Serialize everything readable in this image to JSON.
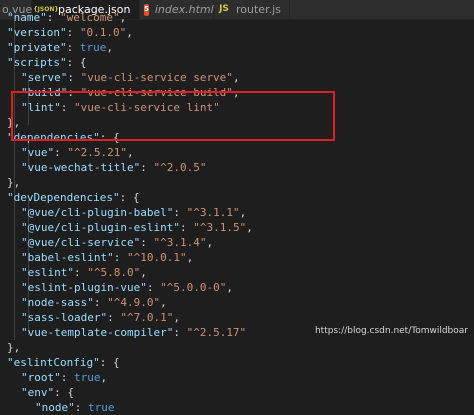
{
  "tabs": [
    {
      "icon": "vue-file-icon",
      "label": "o.vue",
      "active": false,
      "italic": false
    },
    {
      "icon": "json-file-icon",
      "icon_text": "{JSON}",
      "label": "package.json",
      "active": true,
      "italic": false,
      "close": "×"
    },
    {
      "icon": "html-file-icon",
      "icon_text": "5",
      "label": "index.html",
      "active": false,
      "italic": true
    },
    {
      "icon": "js-file-icon",
      "icon_text": "JS",
      "label": "router.js",
      "active": false,
      "italic": false
    }
  ],
  "code_lines": [
    [
      {
        "t": "k",
        "v": "\"name\""
      },
      {
        "t": "p",
        "v": ": "
      },
      {
        "t": "s",
        "v": "\"welcome\""
      },
      {
        "t": "p",
        "v": ","
      }
    ],
    [
      {
        "t": "k",
        "v": "\"version\""
      },
      {
        "t": "p",
        "v": ": "
      },
      {
        "t": "s",
        "v": "\"0.1.0\""
      },
      {
        "t": "p",
        "v": ","
      }
    ],
    [
      {
        "t": "k",
        "v": "\"private\""
      },
      {
        "t": "p",
        "v": ": "
      },
      {
        "t": "b",
        "v": "true"
      },
      {
        "t": "p",
        "v": ","
      }
    ],
    [
      {
        "t": "k",
        "v": "\"scripts\""
      },
      {
        "t": "p",
        "v": ": {"
      }
    ],
    [
      {
        "t": "k",
        "v": "\"serve\""
      },
      {
        "t": "p",
        "v": ": "
      },
      {
        "t": "s",
        "v": "\"vue-cli-service serve\""
      },
      {
        "t": "p",
        "v": ","
      }
    ],
    [
      {
        "t": "k",
        "v": "\"build\""
      },
      {
        "t": "p",
        "v": ": "
      },
      {
        "t": "s",
        "v": "\"vue-cli-service build\""
      },
      {
        "t": "p",
        "v": ","
      }
    ],
    [
      {
        "t": "k",
        "v": "\"lint\""
      },
      {
        "t": "p",
        "v": ": "
      },
      {
        "t": "s",
        "v": "\"vue-cli-service lint\""
      }
    ],
    [
      {
        "t": "p",
        "v": "},"
      }
    ],
    [
      {
        "t": "k",
        "v": "\"dependencies\""
      },
      {
        "t": "p",
        "v": ": {"
      }
    ],
    [
      {
        "t": "k",
        "v": "\"vue\""
      },
      {
        "t": "p",
        "v": ": "
      },
      {
        "t": "s",
        "v": "\"^2.5.21\""
      },
      {
        "t": "p",
        "v": ","
      }
    ],
    [
      {
        "t": "k",
        "v": "\"vue-wechat-title\""
      },
      {
        "t": "p",
        "v": ": "
      },
      {
        "t": "s",
        "v": "\"^2.0.5\""
      }
    ],
    [
      {
        "t": "p",
        "v": "},"
      }
    ],
    [
      {
        "t": "k",
        "v": "\"devDependencies\""
      },
      {
        "t": "p",
        "v": ": {"
      }
    ],
    [
      {
        "t": "k",
        "v": "\"@vue/cli-plugin-babel\""
      },
      {
        "t": "p",
        "v": ": "
      },
      {
        "t": "s",
        "v": "\"^3.1.1\""
      },
      {
        "t": "p",
        "v": ","
      }
    ],
    [
      {
        "t": "k",
        "v": "\"@vue/cli-plugin-eslint\""
      },
      {
        "t": "p",
        "v": ": "
      },
      {
        "t": "s",
        "v": "\"^3.1.5\""
      },
      {
        "t": "p",
        "v": ","
      }
    ],
    [
      {
        "t": "k",
        "v": "\"@vue/cli-service\""
      },
      {
        "t": "p",
        "v": ": "
      },
      {
        "t": "s",
        "v": "\"^3.1.4\""
      },
      {
        "t": "p",
        "v": ","
      }
    ],
    [
      {
        "t": "k",
        "v": "\"babel-eslint\""
      },
      {
        "t": "p",
        "v": ": "
      },
      {
        "t": "s",
        "v": "\"^10.0.1\""
      },
      {
        "t": "p",
        "v": ","
      }
    ],
    [
      {
        "t": "k",
        "v": "\"eslint\""
      },
      {
        "t": "p",
        "v": ": "
      },
      {
        "t": "s",
        "v": "\"^5.8.0\""
      },
      {
        "t": "p",
        "v": ","
      }
    ],
    [
      {
        "t": "k",
        "v": "\"eslint-plugin-vue\""
      },
      {
        "t": "p",
        "v": ": "
      },
      {
        "t": "s",
        "v": "\"^5.0.0-0\""
      },
      {
        "t": "p",
        "v": ","
      }
    ],
    [
      {
        "t": "k",
        "v": "\"node-sass\""
      },
      {
        "t": "p",
        "v": ": "
      },
      {
        "t": "s",
        "v": "\"^4.9.0\""
      },
      {
        "t": "p",
        "v": ","
      }
    ],
    [
      {
        "t": "k",
        "v": "\"sass-loader\""
      },
      {
        "t": "p",
        "v": ": "
      },
      {
        "t": "s",
        "v": "\"^7.0.1\""
      },
      {
        "t": "p",
        "v": ","
      }
    ],
    [
      {
        "t": "k",
        "v": "\"vue-template-compiler\""
      },
      {
        "t": "p",
        "v": ": "
      },
      {
        "t": "s",
        "v": "\"^2.5.17\""
      }
    ],
    [
      {
        "t": "p",
        "v": "},"
      }
    ],
    [
      {
        "t": "k",
        "v": "\"eslintConfig\""
      },
      {
        "t": "p",
        "v": ": {"
      }
    ],
    [
      {
        "t": "k",
        "v": "\"root\""
      },
      {
        "t": "p",
        "v": ": "
      },
      {
        "t": "b",
        "v": "true"
      },
      {
        "t": "p",
        "v": ","
      }
    ],
    [
      {
        "t": "k",
        "v": "\"env\""
      },
      {
        "t": "p",
        "v": ": {"
      }
    ],
    [
      {
        "t": "k",
        "v": "\"node\""
      },
      {
        "t": "p",
        "v": ": "
      },
      {
        "t": "b",
        "v": "true"
      }
    ]
  ],
  "watermark": "https://blog.csdn.net/Tomwildboar",
  "colors": {
    "background": "#1e1e1e",
    "key": "#9cdcfe",
    "string": "#ce9178",
    "boolean": "#569cd6",
    "punctuation": "#d4d4d4",
    "highlight_box": "#e02020"
  }
}
